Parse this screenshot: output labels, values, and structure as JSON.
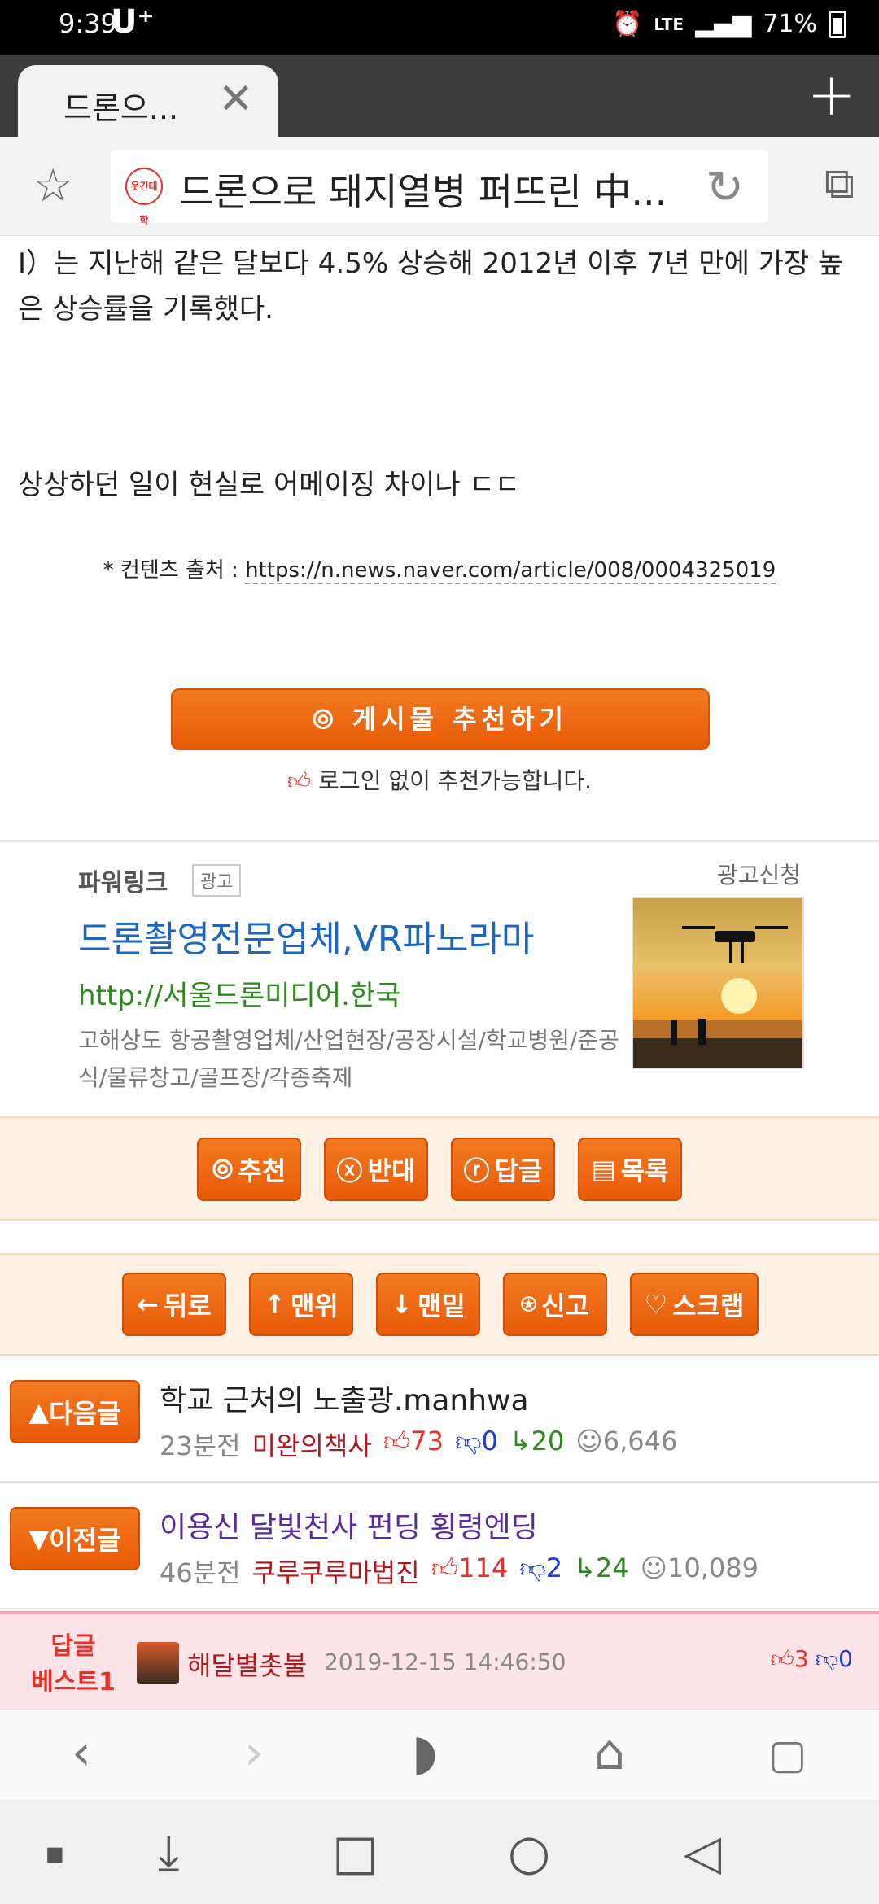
{
  "status_bar": {
    "time": "9:39",
    "carrier": "U⁺",
    "battery": "71%",
    "icons": [
      "alarm-icon",
      "lte-icon",
      "signal-icon",
      "battery-icon"
    ]
  },
  "tab": {
    "title": "드론으...",
    "new_tab_label": "+"
  },
  "address_bar": {
    "favicon_text": "웃긴대학",
    "page_title": "드론으로 돼지열병 퍼뜨린 中..."
  },
  "article": {
    "para1": "I）는 지난해 같은 달보다 4.5% 상승해 2012년 이후 7년 만에 가장 높은 상승률을 기록했다.",
    "para2": "상상하던 일이 현실로 어메이징 차이나 ㄷㄷ",
    "source_prefix": "* 컨텐츠 출처 : ",
    "source_url": "https://n.news.naver.com/article/008/0004325019"
  },
  "recommend": {
    "button_label": "게시물 추천하기",
    "note": "로그인 없이 추천가능합니다."
  },
  "ad": {
    "label": "파워링크",
    "badge": "광고",
    "apply": "광고신청",
    "title": "드론촬영전문업체,VR파노라마",
    "url": "http://서울드론미디어.한국",
    "description": "고해상도 항공촬영업체/산업현장/공장시설/학교병원/준공식/물류창고/골프장/각종축제"
  },
  "action_bar_1": {
    "buttons": [
      "추천",
      "반대",
      "답글",
      "목록"
    ]
  },
  "action_bar_2": {
    "buttons": [
      "뒤로",
      "맨위",
      "맨밑",
      "신고",
      "스크랩"
    ]
  },
  "next_post": {
    "label": "다음글",
    "title": "학교 근처의 노출광.manhwa",
    "time": "23분전",
    "author": "미완의책사",
    "up": "73",
    "down": "0",
    "replies": "20",
    "views": "6,646"
  },
  "prev_post": {
    "label": "이전글",
    "title": "이용신 달빛천사 펀딩 횡령엔딩",
    "time": "46분전",
    "author": "쿠루쿠루마법진",
    "up": "114",
    "down": "2",
    "replies": "24",
    "views": "10,089"
  },
  "best_reply": {
    "label_line1": "답글",
    "label_line2": "베스트1",
    "user": "해달별촛불",
    "date": "2019-12-15 14:46:50",
    "up": "3",
    "down": "0"
  },
  "colors": {
    "accent": "#e85a08",
    "ad_title": "#1a66c0",
    "ad_url": "#2a8a1a",
    "best_bg": "#fde4e8"
  }
}
